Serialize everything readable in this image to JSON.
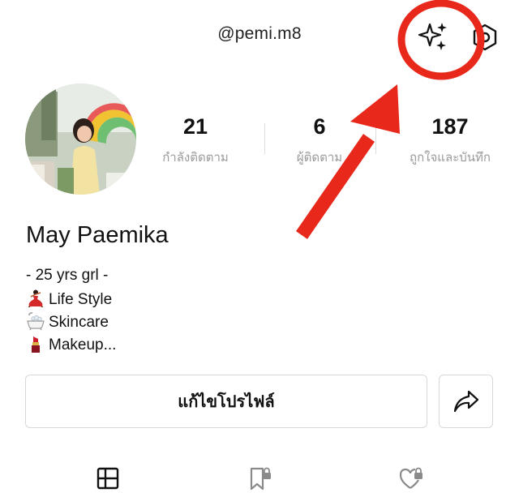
{
  "header": {
    "username": "@pemi.m8",
    "icons": [
      "sparkle-icon",
      "hexagon-settings-icon"
    ]
  },
  "stats": [
    {
      "value": "21",
      "label": "กำลังติดตาม"
    },
    {
      "value": "6",
      "label": "ผู้ติดตาม"
    },
    {
      "value": "187",
      "label": "ถูกใจและบันทึก"
    }
  ],
  "profile": {
    "name": "May Paemika",
    "bio": [
      "- 25 yrs grl -",
      "Life Style",
      "Skincare",
      "Makeup..."
    ],
    "bio_icons": [
      "dancer-emoji",
      "bathtub-emoji",
      "lipstick-emoji"
    ]
  },
  "actions": {
    "edit_label": "แก้ไขโปรไฟล์",
    "share_icon": "share-arrow-icon"
  },
  "tabs": [
    "grid-icon",
    "bookmark-lock-icon",
    "heart-lock-icon"
  ],
  "annotation": {
    "color": "#e8281a",
    "highlight": "circle around sparkle icon with arrow pointing to it"
  }
}
